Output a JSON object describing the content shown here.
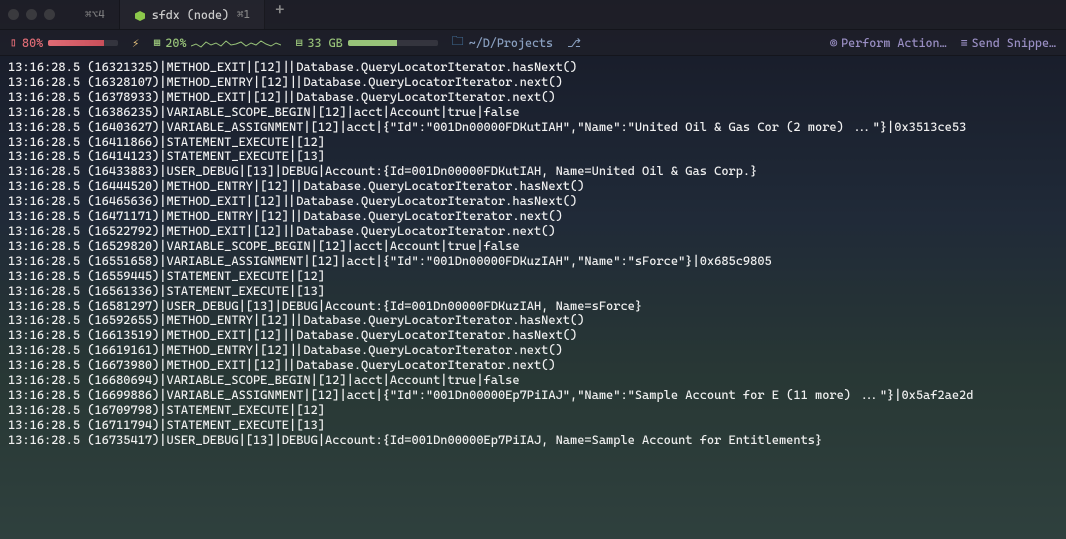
{
  "tabs": {
    "first_shortcut": "⌘⌥4",
    "second_title": "sfdx (node)",
    "second_shortcut": "⌘1"
  },
  "status": {
    "battery_pct": "80%",
    "cpu_pct": "20%",
    "ram": "33 GB",
    "folder": "~/D/Projects",
    "perform_action": "Perform Action…",
    "send_snippet": "Send Snippe…"
  },
  "log_lines": [
    "13:16:28.5 (16321325)|METHOD_EXIT|[12]||Database.QueryLocatorIterator.hasNext()",
    "13:16:28.5 (16328107)|METHOD_ENTRY|[12]||Database.QueryLocatorIterator.next()",
    "13:16:28.5 (16378933)|METHOD_EXIT|[12]||Database.QueryLocatorIterator.next()",
    "13:16:28.5 (16386235)|VARIABLE_SCOPE_BEGIN|[12]|acct|Account|true|false",
    "13:16:28.5 (16403627)|VARIABLE_ASSIGNMENT|[12]|acct|{\"Id\":\"001Dn00000FDKutIAH\",\"Name\":\"United Oil & Gas Cor (2 more) ...\"}|0x3513ce53",
    "13:16:28.5 (16411866)|STATEMENT_EXECUTE|[12]",
    "13:16:28.5 (16414123)|STATEMENT_EXECUTE|[13]",
    "13:16:28.5 (16433883)|USER_DEBUG|[13]|DEBUG|Account:{Id=001Dn00000FDKutIAH, Name=United Oil & Gas Corp.}",
    "13:16:28.5 (16444520)|METHOD_ENTRY|[12]||Database.QueryLocatorIterator.hasNext()",
    "13:16:28.5 (16465636)|METHOD_EXIT|[12]||Database.QueryLocatorIterator.hasNext()",
    "13:16:28.5 (16471171)|METHOD_ENTRY|[12]||Database.QueryLocatorIterator.next()",
    "13:16:28.5 (16522792)|METHOD_EXIT|[12]||Database.QueryLocatorIterator.next()",
    "13:16:28.5 (16529820)|VARIABLE_SCOPE_BEGIN|[12]|acct|Account|true|false",
    "13:16:28.5 (16551658)|VARIABLE_ASSIGNMENT|[12]|acct|{\"Id\":\"001Dn00000FDKuzIAH\",\"Name\":\"sForce\"}|0x685c9805",
    "13:16:28.5 (16559445)|STATEMENT_EXECUTE|[12]",
    "13:16:28.5 (16561336)|STATEMENT_EXECUTE|[13]",
    "13:16:28.5 (16581297)|USER_DEBUG|[13]|DEBUG|Account:{Id=001Dn00000FDKuzIAH, Name=sForce}",
    "13:16:28.5 (16592655)|METHOD_ENTRY|[12]||Database.QueryLocatorIterator.hasNext()",
    "13:16:28.5 (16613519)|METHOD_EXIT|[12]||Database.QueryLocatorIterator.hasNext()",
    "13:16:28.5 (16619161)|METHOD_ENTRY|[12]||Database.QueryLocatorIterator.next()",
    "13:16:28.5 (16673980)|METHOD_EXIT|[12]||Database.QueryLocatorIterator.next()",
    "13:16:28.5 (16680694)|VARIABLE_SCOPE_BEGIN|[12]|acct|Account|true|false",
    "13:16:28.5 (16699886)|VARIABLE_ASSIGNMENT|[12]|acct|{\"Id\":\"001Dn00000Ep7PiIAJ\",\"Name\":\"Sample Account for E (11 more) ...\"}|0x5af2ae2d",
    "13:16:28.5 (16709798)|STATEMENT_EXECUTE|[12]",
    "13:16:28.5 (16711794)|STATEMENT_EXECUTE|[13]",
    "13:16:28.5 (16735417)|USER_DEBUG|[13]|DEBUG|Account:{Id=001Dn00000Ep7PiIAJ, Name=Sample Account for Entitlements}"
  ]
}
